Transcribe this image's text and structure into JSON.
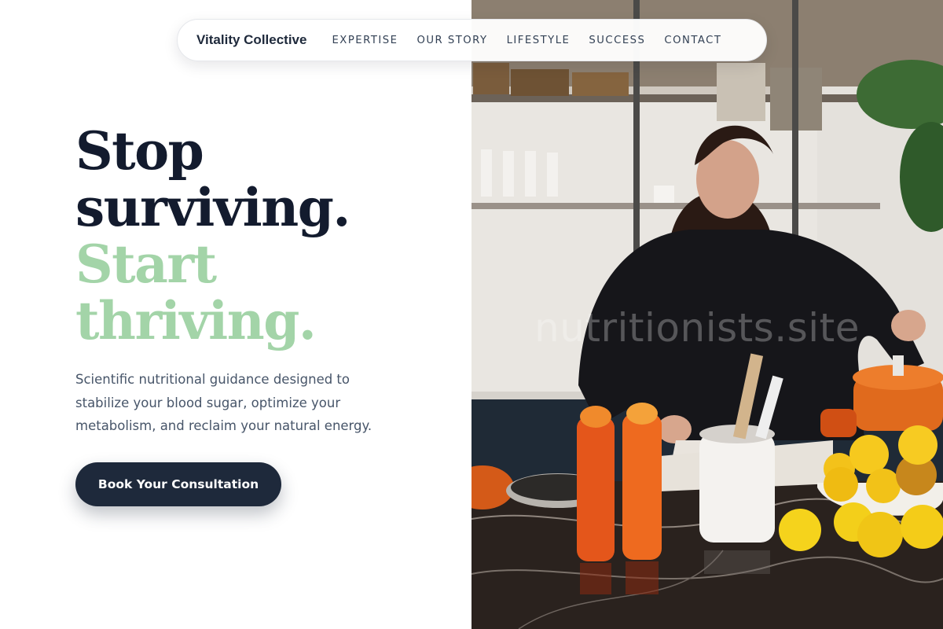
{
  "brand": {
    "name": "Vitality Collective"
  },
  "nav": {
    "items": [
      {
        "label": "EXPERTISE"
      },
      {
        "label": "OUR STORY"
      },
      {
        "label": "LIFESTYLE"
      },
      {
        "label": "SUCCESS"
      },
      {
        "label": "CONTACT"
      }
    ]
  },
  "hero": {
    "headline_dark": [
      "Stop",
      "surviving."
    ],
    "headline_accent": [
      "Start",
      "thriving."
    ],
    "subtitle": "Scientific nutritional guidance designed to stabilize your blood sugar, optimize your metabolism, and reclaim your natural energy.",
    "cta_label": "Book Your Consultation"
  },
  "image": {
    "watermark": "nutritionists.site"
  },
  "colors": {
    "headline_dark": "#131b2e",
    "headline_accent": "#a3d4a8",
    "button_bg": "#1e293b",
    "body_text": "#475569"
  }
}
